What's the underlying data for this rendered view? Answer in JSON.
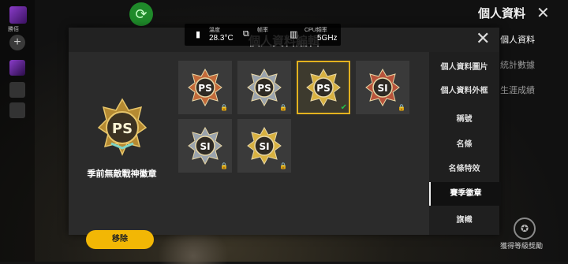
{
  "header": {
    "title": "個人資料",
    "modal_title": "個人資料編輯"
  },
  "rail": {
    "label": "勝佰",
    "add_symbol": "+"
  },
  "right_menu": [
    {
      "label": "個人資料"
    },
    {
      "label": "統計數據"
    },
    {
      "label": "生涯成績"
    }
  ],
  "reward": {
    "label": "獲得等級獎勵"
  },
  "selected_badge": {
    "name": "季前無敵戰神徽章",
    "remove_label": "移除"
  },
  "badges": [
    {
      "code": "PS",
      "locked": true,
      "selected": false,
      "tint": "#c26a3a"
    },
    {
      "code": "PS",
      "locked": true,
      "selected": false,
      "tint": "#9aa3ad"
    },
    {
      "code": "PS",
      "locked": false,
      "selected": true,
      "tint": "#d8b140"
    },
    {
      "code": "SI",
      "locked": true,
      "selected": false,
      "tint": "#b8533b"
    },
    {
      "code": "SI",
      "locked": true,
      "selected": false,
      "tint": "#9aa3ad"
    },
    {
      "code": "SI",
      "locked": true,
      "selected": false,
      "tint": "#d8b140"
    }
  ],
  "side_menu": [
    {
      "label": "個人資料圖片",
      "active": false
    },
    {
      "label": "個人資料外框",
      "active": false
    },
    {
      "label": "稱號",
      "active": false
    },
    {
      "label": "名條",
      "active": false
    },
    {
      "label": "名條特效",
      "active": false
    },
    {
      "label": "賽季徽章",
      "active": true
    },
    {
      "label": "旗幟",
      "active": false
    }
  ],
  "perf": {
    "temp_label": "溫度",
    "temp_value": "28.3°C",
    "fps_label": "帧率",
    "cpu_label": "CPU頻率",
    "cpu_value": "5GHz"
  },
  "colors": {
    "accent": "#f2b705",
    "selected_outline": "#e3b21f",
    "check": "#25c04a"
  }
}
